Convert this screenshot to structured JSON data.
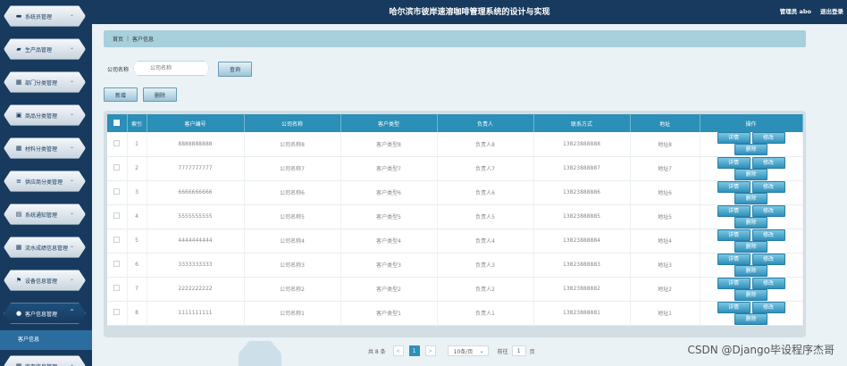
{
  "header": {
    "title": "哈尔滨市彼岸速溶咖啡管理系统的设计与实现",
    "admin": "管理员 abo",
    "logout": "退出登录"
  },
  "sidebar": {
    "items": [
      {
        "label": "系统员管理",
        "icon": "monitor-icon"
      },
      {
        "label": "生产品管理",
        "icon": "truck-icon"
      },
      {
        "label": "部门分类管理",
        "icon": "grid-icon"
      },
      {
        "label": "商品分类管理",
        "icon": "check-icon"
      },
      {
        "label": "材料分类管理",
        "icon": "grid-icon"
      },
      {
        "label": "供应商分类管理",
        "icon": "list-icon"
      },
      {
        "label": "系统通知管理",
        "icon": "doc-icon"
      },
      {
        "label": "流水成绩信息管理",
        "icon": "grid-icon"
      },
      {
        "label": "设备信息管理",
        "icon": "flag-icon"
      },
      {
        "label": "客户信息管理",
        "icon": "user-icon"
      },
      {
        "label": "库存信息管理",
        "icon": "grid-icon"
      }
    ],
    "sub_item": "客户信息"
  },
  "breadcrumb": {
    "home": "首页",
    "current": "客户信息"
  },
  "search": {
    "label": "公司名称",
    "placeholder": "公司名称",
    "query_button": "查询"
  },
  "actions": {
    "add": "新增",
    "delete": "删除"
  },
  "table": {
    "columns": [
      "索引",
      "客户编号",
      "公司名称",
      "客户类型",
      "负责人",
      "联系方式",
      "地址",
      "操作"
    ],
    "rows": [
      {
        "index": "1",
        "code": "8888888888",
        "company": "公司名称8",
        "type": "客户类型8",
        "owner": "负责人8",
        "phone": "13823888888",
        "address": "地址8"
      },
      {
        "index": "2",
        "code": "7777777777",
        "company": "公司名称7",
        "type": "客户类型7",
        "owner": "负责人7",
        "phone": "13823888887",
        "address": "地址7"
      },
      {
        "index": "3",
        "code": "6666666666",
        "company": "公司名称6",
        "type": "客户类型6",
        "owner": "负责人6",
        "phone": "13823888886",
        "address": "地址6"
      },
      {
        "index": "4",
        "code": "5555555555",
        "company": "公司名称5",
        "type": "客户类型5",
        "owner": "负责人5",
        "phone": "13823888885",
        "address": "地址5"
      },
      {
        "index": "5",
        "code": "4444444444",
        "company": "公司名称4",
        "type": "客户类型4",
        "owner": "负责人4",
        "phone": "13823888884",
        "address": "地址4"
      },
      {
        "index": "6",
        "code": "3333333333",
        "company": "公司名称3",
        "type": "客户类型3",
        "owner": "负责人3",
        "phone": "13823888883",
        "address": "地址3"
      },
      {
        "index": "7",
        "code": "2222222222",
        "company": "公司名称2",
        "type": "客户类型2",
        "owner": "负责人2",
        "phone": "13823888882",
        "address": "地址2"
      },
      {
        "index": "8",
        "code": "1111111111",
        "company": "公司名称1",
        "type": "客户类型1",
        "owner": "负责人1",
        "phone": "13823888881",
        "address": "地址1"
      }
    ],
    "row_buttons": {
      "detail": "详情",
      "edit": "修改",
      "delete": "删除"
    }
  },
  "pagination": {
    "total": "共 8 条",
    "prev": "<",
    "page": "1",
    "next": ">",
    "page_size": "10条/页",
    "goto": "前往",
    "goto_value": "1",
    "page_unit": "页"
  },
  "watermark": "CSDN @Django毕设程序杰哥"
}
